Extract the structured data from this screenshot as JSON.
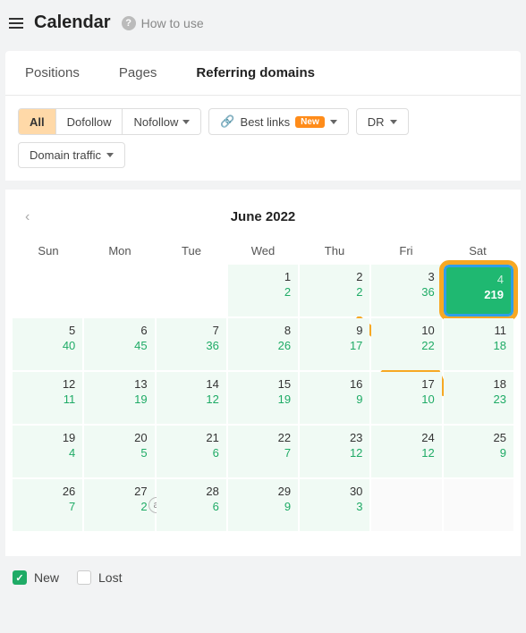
{
  "header": {
    "title": "Calendar",
    "help": "How to use"
  },
  "tabs": {
    "positions": "Positions",
    "pages": "Pages",
    "referring": "Referring domains"
  },
  "filters": {
    "all": "All",
    "dofollow": "Dofollow",
    "nofollow": "Nofollow",
    "bestlinks": "Best links",
    "new_badge": "New",
    "dr": "DR",
    "domain_traffic": "Domain traffic"
  },
  "calendar": {
    "month": "June 2022",
    "daynames": [
      "Sun",
      "Mon",
      "Tue",
      "Wed",
      "Thu",
      "Fri",
      "Sat"
    ],
    "cells": [
      {
        "empty": true
      },
      {
        "empty": true
      },
      {
        "empty": true
      },
      {
        "d": "1",
        "v": "2"
      },
      {
        "d": "2",
        "v": "2"
      },
      {
        "d": "3",
        "v": "36"
      },
      {
        "d": "4",
        "v": "219",
        "sel": true
      },
      {
        "d": "5",
        "v": "40"
      },
      {
        "d": "6",
        "v": "45"
      },
      {
        "d": "7",
        "v": "36"
      },
      {
        "d": "8",
        "v": "26"
      },
      {
        "d": "9",
        "v": "17"
      },
      {
        "d": "10",
        "v": "22"
      },
      {
        "d": "11",
        "v": "18"
      },
      {
        "d": "12",
        "v": "11"
      },
      {
        "d": "13",
        "v": "19"
      },
      {
        "d": "14",
        "v": "12"
      },
      {
        "d": "15",
        "v": "19"
      },
      {
        "d": "16",
        "v": "9"
      },
      {
        "d": "17",
        "v": "10"
      },
      {
        "d": "18",
        "v": "23"
      },
      {
        "d": "19",
        "v": "4"
      },
      {
        "d": "20",
        "v": "5"
      },
      {
        "d": "21",
        "v": "6"
      },
      {
        "d": "22",
        "v": "7"
      },
      {
        "d": "23",
        "v": "12"
      },
      {
        "d": "24",
        "v": "12"
      },
      {
        "d": "25",
        "v": "9"
      },
      {
        "d": "26",
        "v": "7"
      },
      {
        "d": "27",
        "v": "2",
        "a": true
      },
      {
        "d": "28",
        "v": "6"
      },
      {
        "d": "29",
        "v": "9"
      },
      {
        "d": "30",
        "v": "3"
      },
      {
        "empty": true,
        "inactive": true
      },
      {
        "empty": true,
        "inactive": true
      }
    ]
  },
  "legend": {
    "new": "New",
    "lost": "Lost"
  }
}
